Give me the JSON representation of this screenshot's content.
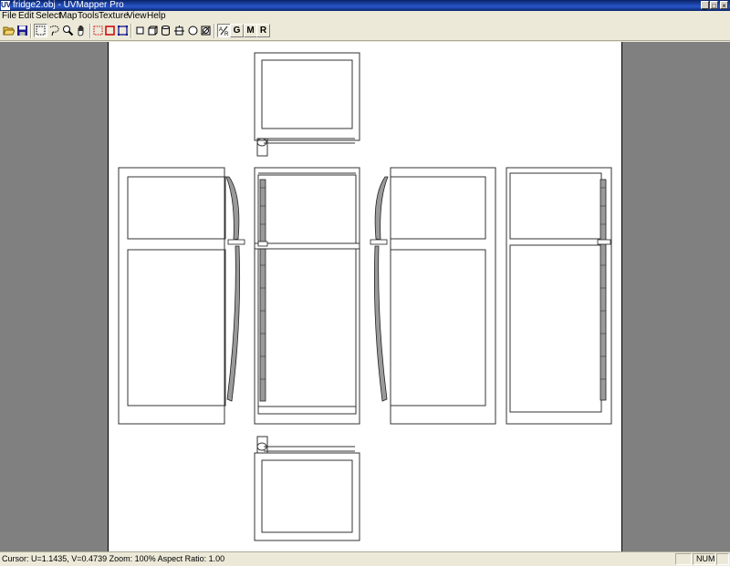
{
  "window": {
    "title": "fridge2.obj - UVMapper Pro",
    "app_icon_glyph": "UV",
    "minimize_glyph": "_",
    "maximize_glyph": "□",
    "close_glyph": "×"
  },
  "menu": {
    "items": [
      {
        "label": "File"
      },
      {
        "label": "Edit"
      },
      {
        "label": "Select"
      },
      {
        "label": "Map"
      },
      {
        "label": "Tools"
      },
      {
        "label": "Texture"
      },
      {
        "label": "View"
      },
      {
        "label": "Help"
      }
    ]
  },
  "toolbar": {
    "buttons": [
      {
        "icon": "open-folder-icon"
      },
      {
        "icon": "save-disk-icon"
      },
      {
        "icon": "rectangle-select-icon",
        "pressed": true
      },
      {
        "icon": "lasso-select-icon"
      },
      {
        "icon": "zoom-magnifier-icon"
      },
      {
        "icon": "pan-hand-icon"
      },
      {
        "icon": "select-vertices-icon",
        "color": "#cc0000"
      },
      {
        "icon": "select-faces-icon",
        "color": "#cc0000"
      },
      {
        "icon": "select-groups-icon",
        "color": "#00008b"
      },
      {
        "icon": "planar-map-icon"
      },
      {
        "icon": "box-map-icon"
      },
      {
        "icon": "cylindrical-map-icon"
      },
      {
        "icon": "cylindrical-cap-map-icon"
      },
      {
        "icon": "spherical-map-icon"
      },
      {
        "icon": "polar-map-icon"
      },
      {
        "icon": "aspect-ratio-icon",
        "pressed": true
      },
      {
        "label": "G"
      },
      {
        "label": "M"
      },
      {
        "label": "R"
      }
    ]
  },
  "status": {
    "text": "Cursor: U=1.1435, V=0.4739  Zoom: 100%  Aspect Ratio: 1.00",
    "num_indicator": "NUM"
  },
  "colors": {
    "workspace_bg": "#808080",
    "canvas_bg": "#ffffff",
    "uv_line": "#333333",
    "uv_fill_dark": "#9a9a9a",
    "titlebar": "#0a246a"
  }
}
